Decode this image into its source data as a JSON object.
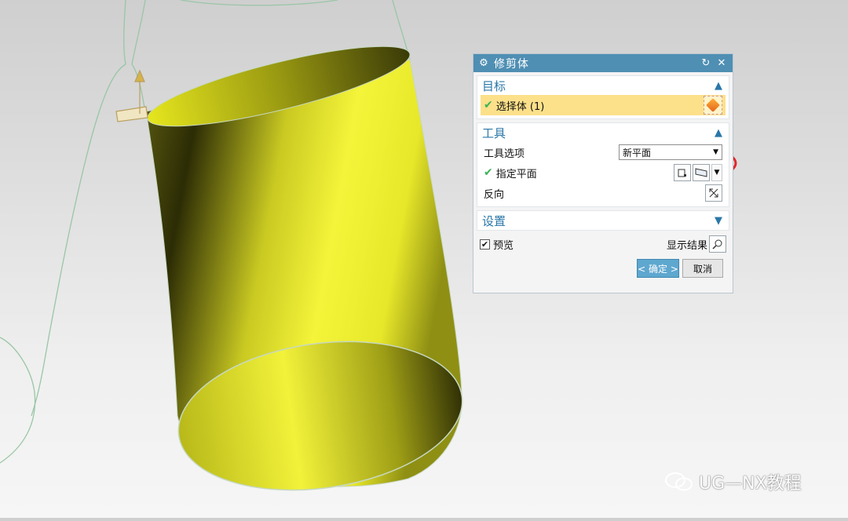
{
  "dialog": {
    "title": "修剪体",
    "sections": {
      "target": {
        "label": "目标",
        "select_body": "选择体 (1)"
      },
      "tool": {
        "label": "工具",
        "tool_option_label": "工具选项",
        "tool_option_value": "新平面",
        "specify_plane_label": "指定平面",
        "reverse_label": "反向"
      },
      "settings": {
        "label": "设置"
      }
    },
    "preview_label": "预览",
    "preview_checked": true,
    "show_result_label": "显示结果",
    "ok_label": "< 确定 >",
    "cancel_label": "取消"
  },
  "watermark": "UG—NX教程",
  "colors": {
    "title_bar": "#4f8fb3",
    "section_header": "#2a77a8",
    "selected_row": "#fce08a",
    "body_yellow": "#f0f020",
    "annotation_circle": "#e0262b"
  }
}
